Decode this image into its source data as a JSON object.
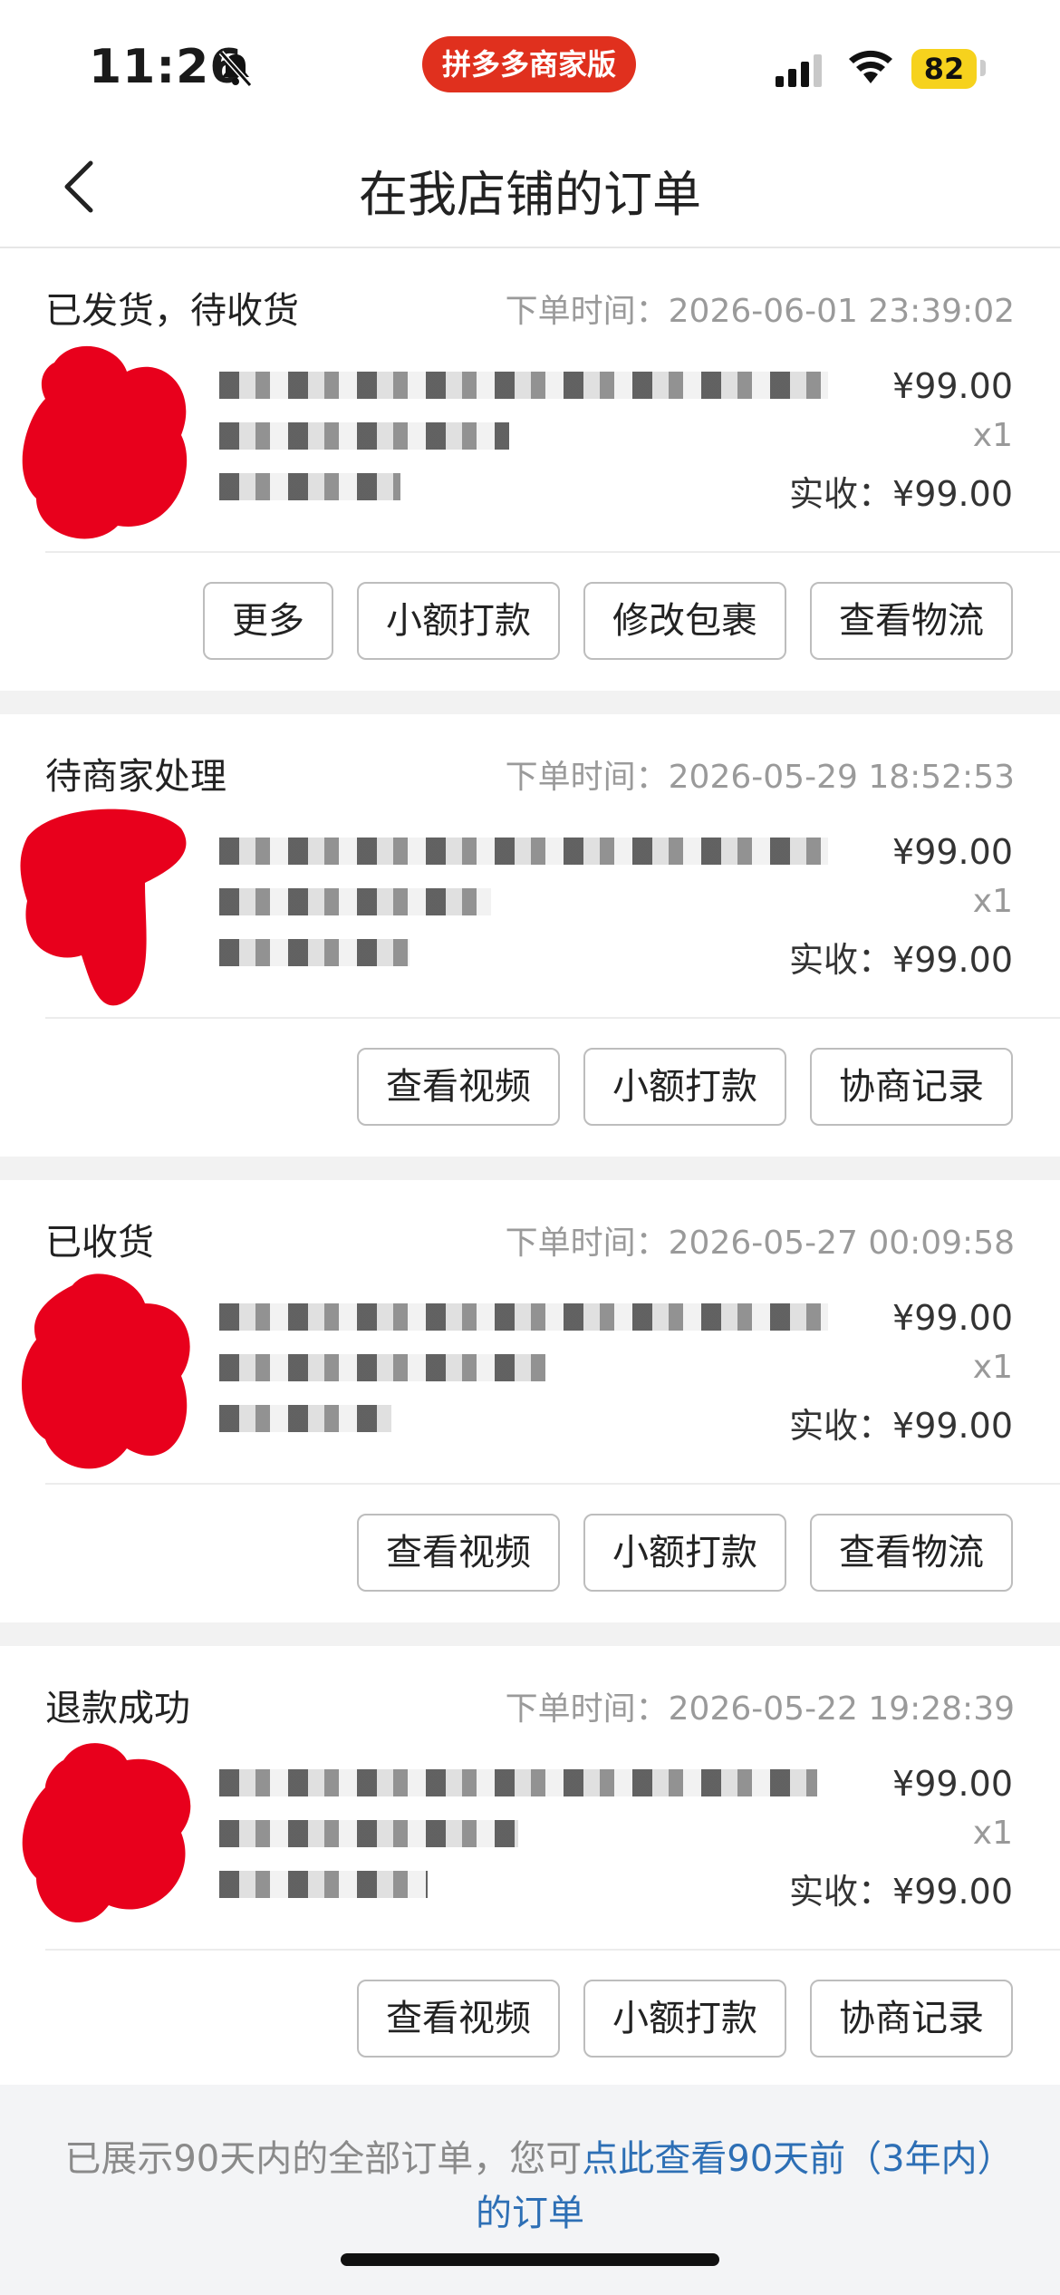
{
  "status_bar": {
    "time": "11:26",
    "app_badge": "拼多多商家版",
    "battery": "82"
  },
  "nav": {
    "title": "在我店铺的订单"
  },
  "orders": [
    {
      "status": "已发货，待收货",
      "time": "下单时间：2026-06-01 23:39:02",
      "price": "¥99.00",
      "qty": "x1",
      "received": "实收：¥99.00",
      "buttons": [
        "更多",
        "小额打款",
        "修改包裹",
        "查看物流"
      ]
    },
    {
      "status": "待商家处理",
      "time": "下单时间：2026-05-29 18:52:53",
      "price": "¥99.00",
      "qty": "x1",
      "received": "实收：¥99.00",
      "buttons": [
        "查看视频",
        "小额打款",
        "协商记录"
      ]
    },
    {
      "status": "已收货",
      "time": "下单时间：2026-05-27 00:09:58",
      "price": "¥99.00",
      "qty": "x1",
      "received": "实收：¥99.00",
      "buttons": [
        "查看视频",
        "小额打款",
        "查看物流"
      ]
    },
    {
      "status": "退款成功",
      "time": "下单时间：2026-05-22 19:28:39",
      "price": "¥99.00",
      "qty": "x1",
      "received": "实收：¥99.00",
      "buttons": [
        "查看视频",
        "小额打款",
        "协商记录"
      ]
    }
  ],
  "footer": {
    "prefix": "已展示90天内的全部订单，您可",
    "link": "点此查看90天前（3年内）的订单"
  },
  "colors": {
    "brand_red": "#e0301e",
    "link_blue": "#2d6fb5",
    "battery_yellow": "#f6d21d"
  }
}
